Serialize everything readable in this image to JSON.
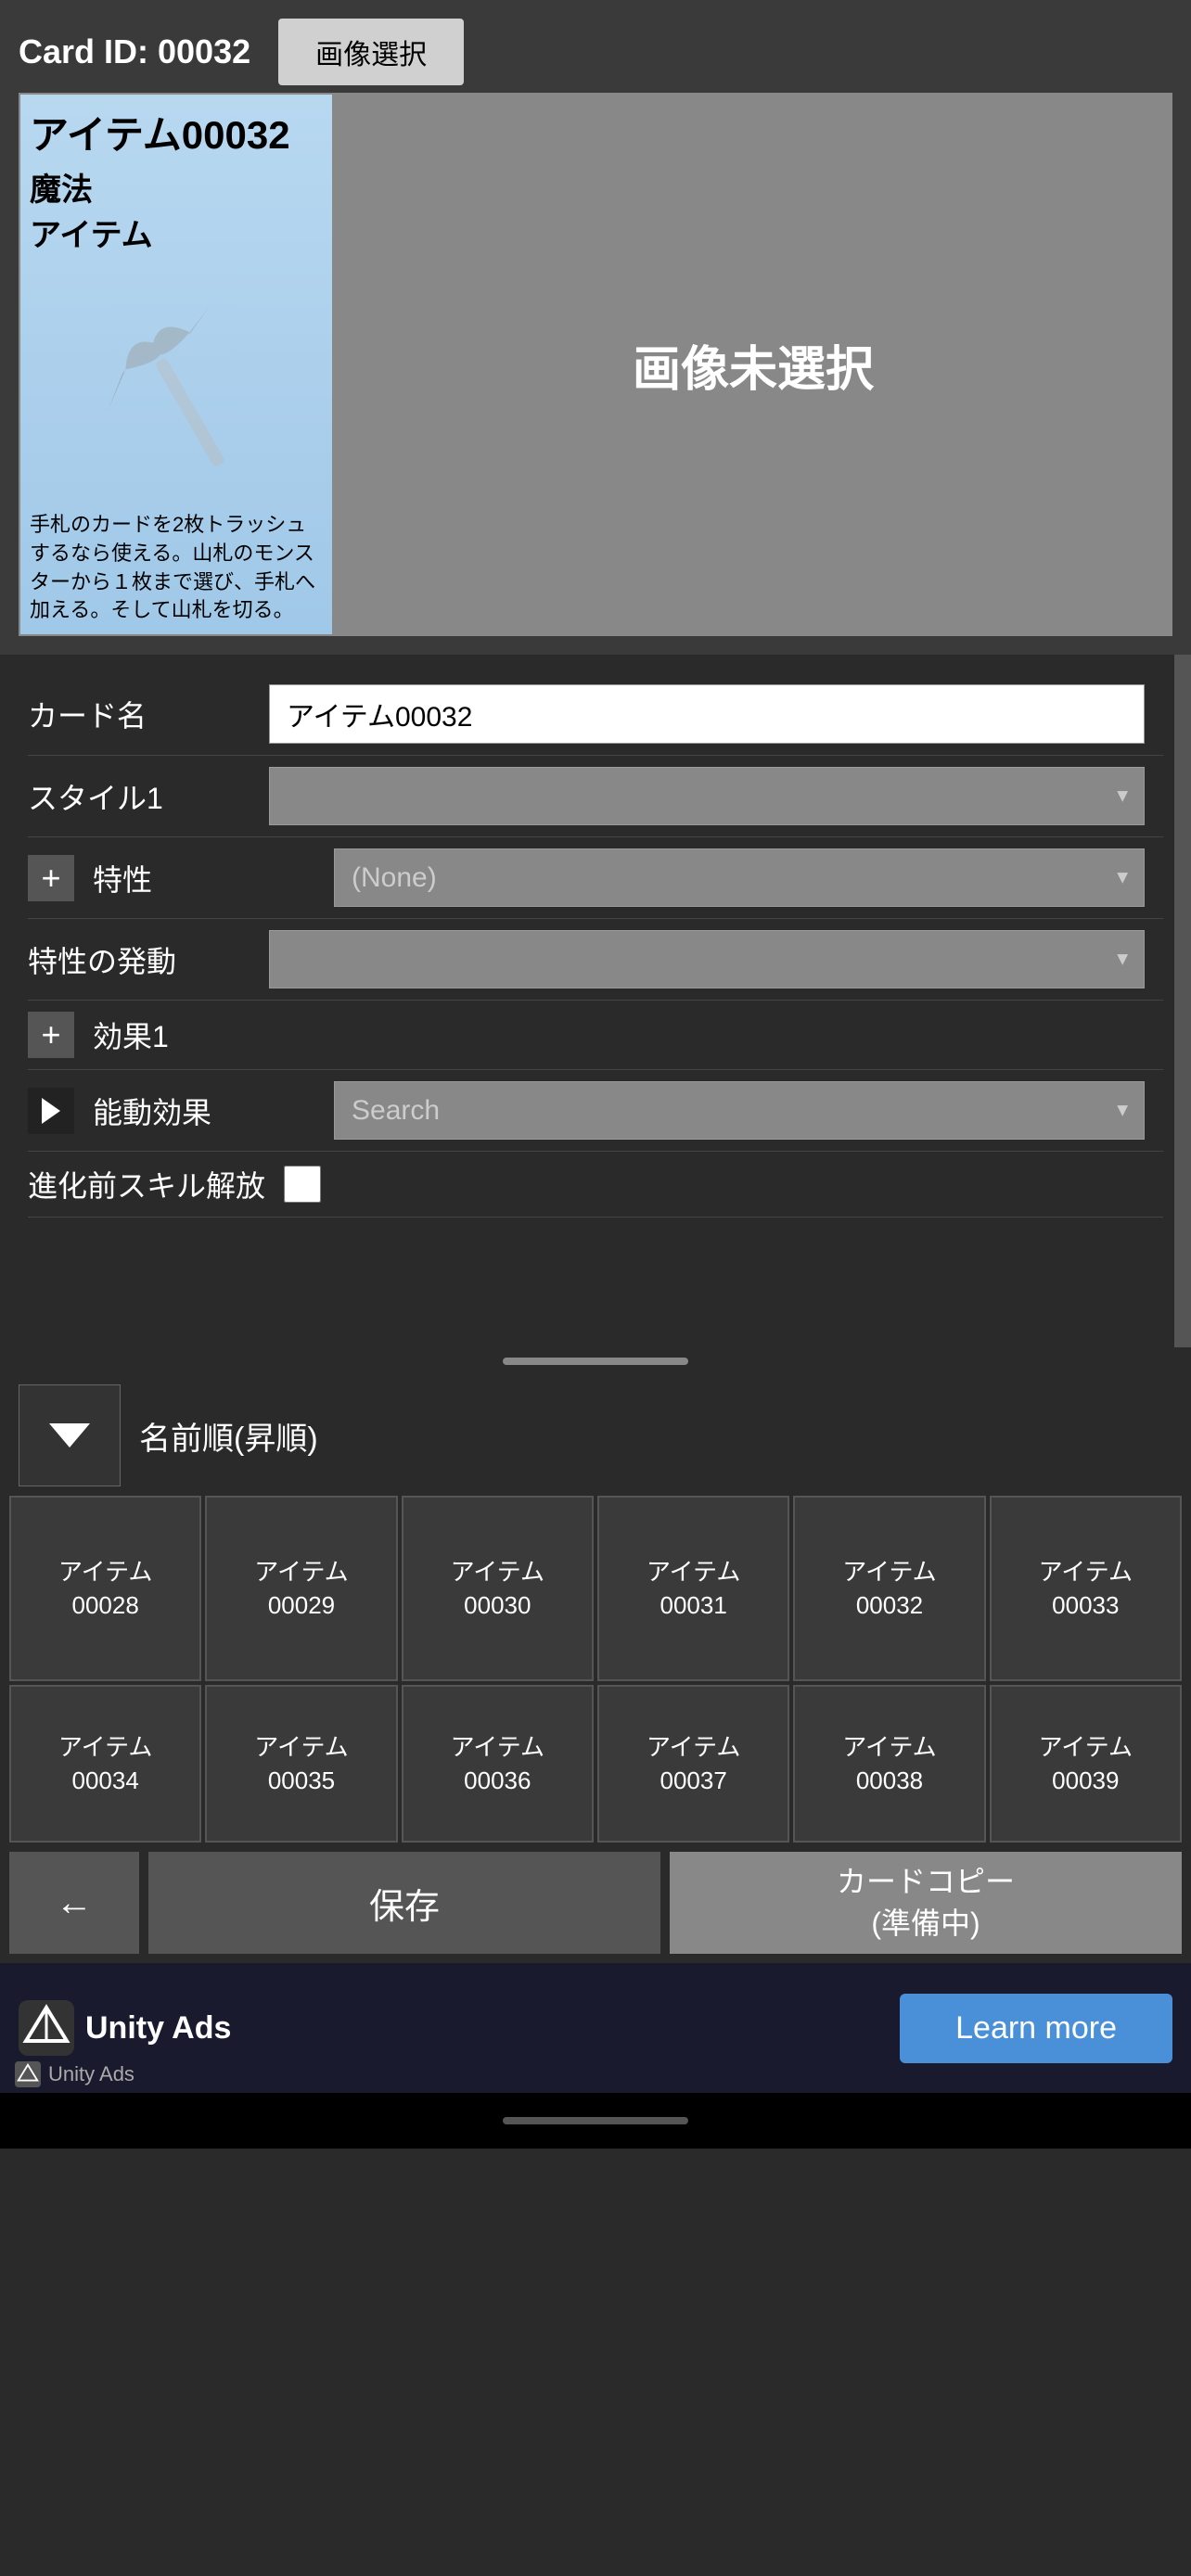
{
  "card": {
    "id_label": "Card ID: 00032",
    "image_select_btn": "画像選択",
    "title": "アイテム00032",
    "type1": "魔法",
    "type2": "アイテム",
    "description": "手札のカードを2枚トラッシュするなら使える。山札のモンスターから１枚まで選び、手札へ加える。そして山札を切る。",
    "image_unselected": "画像未選択"
  },
  "form": {
    "card_name_label": "カード名",
    "card_name_value": "アイテム00032",
    "style1_label": "スタイル1",
    "trait_label": "特性",
    "trait_value": "(None)",
    "trait_trigger_label": "特性の発動",
    "effect1_label": "効果1",
    "active_effect_label": "能動効果",
    "search_placeholder": "Search",
    "evolution_label": "進化前スキル解放"
  },
  "sort": {
    "label": "名前順(昇順)"
  },
  "grid": {
    "rows": [
      [
        {
          "label": "アイテム\n00028"
        },
        {
          "label": "アイテム\n00029"
        },
        {
          "label": "アイテム\n00030"
        },
        {
          "label": "アイテム\n00031"
        },
        {
          "label": "アイテム\n00032"
        },
        {
          "label": "アイテム\n00033"
        }
      ],
      [
        {
          "label": "アイテム\n00034"
        },
        {
          "label": "アイテム\n00035"
        },
        {
          "label": "アイテム\n00036"
        },
        {
          "label": "アイテム\n00037"
        },
        {
          "label": "アイテム\n00038"
        },
        {
          "label": "アイテム\n00039"
        }
      ]
    ]
  },
  "bottom_bar": {
    "back_arrow": "←",
    "save_label": "保存",
    "copy_label": "カードコピー\n(準備中)"
  },
  "ad": {
    "unity_ads_label": "Unity Ads",
    "learn_more_label": "Learn more",
    "unity_ads_small": "Unity Ads"
  }
}
